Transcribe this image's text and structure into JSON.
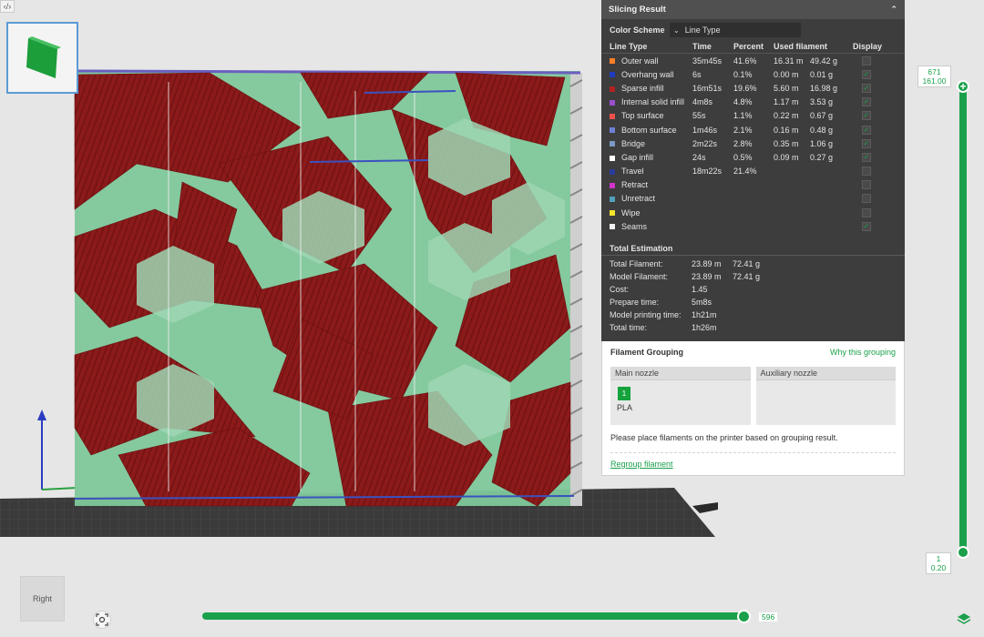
{
  "toolbar": {
    "toggle_label": "‹/›"
  },
  "panel": {
    "title": "Slicing Result",
    "color_scheme_label": "Color Scheme",
    "color_scheme_value": "Line Type",
    "columns": {
      "type": "Line Type",
      "time": "Time",
      "percent": "Percent",
      "filament": "Used filament",
      "display": "Display"
    },
    "rows": [
      {
        "name": "Outer wall",
        "color": "#ff7f27",
        "time": "35m45s",
        "percent": "41.6%",
        "meters": "16.31 m",
        "grams": "49.42 g",
        "checked": false
      },
      {
        "name": "Overhang wall",
        "color": "#1f3cc0",
        "time": "6s",
        "percent": "0.1%",
        "meters": "0.00 m",
        "grams": "0.01 g",
        "checked": true
      },
      {
        "name": "Sparse infill",
        "color": "#b22222",
        "time": "16m51s",
        "percent": "19.6%",
        "meters": "5.60 m",
        "grams": "16.98 g",
        "checked": true
      },
      {
        "name": "Internal solid infill",
        "color": "#9b4fcf",
        "time": "4m8s",
        "percent": "4.8%",
        "meters": "1.17 m",
        "grams": "3.53 g",
        "checked": true
      },
      {
        "name": "Top surface",
        "color": "#f0504a",
        "time": "55s",
        "percent": "1.1%",
        "meters": "0.22 m",
        "grams": "0.67 g",
        "checked": true
      },
      {
        "name": "Bottom surface",
        "color": "#6d80d6",
        "time": "1m46s",
        "percent": "2.1%",
        "meters": "0.16 m",
        "grams": "0.48 g",
        "checked": true
      },
      {
        "name": "Bridge",
        "color": "#7a99c4",
        "time": "2m22s",
        "percent": "2.8%",
        "meters": "0.35 m",
        "grams": "1.06 g",
        "checked": true
      },
      {
        "name": "Gap infill",
        "color": "#ffffff",
        "time": "24s",
        "percent": "0.5%",
        "meters": "0.09 m",
        "grams": "0.27 g",
        "checked": true
      },
      {
        "name": "Travel",
        "color": "#2c3c9c",
        "time": "18m22s",
        "percent": "21.4%",
        "meters": "",
        "grams": "",
        "checked": false
      },
      {
        "name": "Retract",
        "color": "#d233c8",
        "time": "",
        "percent": "",
        "meters": "",
        "grams": "",
        "checked": false
      },
      {
        "name": "Unretract",
        "color": "#4fa0b8",
        "time": "",
        "percent": "",
        "meters": "",
        "grams": "",
        "checked": false
      },
      {
        "name": "Wipe",
        "color": "#f5e52b",
        "time": "",
        "percent": "",
        "meters": "",
        "grams": "",
        "checked": false
      },
      {
        "name": "Seams",
        "color": "#f2f2f2",
        "time": "",
        "percent": "",
        "meters": "",
        "grams": "",
        "checked": true
      }
    ],
    "estimation_title": "Total Estimation",
    "estimation": [
      {
        "label": "Total Filament:",
        "v1": "23.89 m",
        "v2": "72.41 g"
      },
      {
        "label": "Model Filament:",
        "v1": "23.89 m",
        "v2": "72.41 g"
      },
      {
        "label": "Cost:",
        "v1": "1.45",
        "v2": ""
      },
      {
        "label": "Prepare time:",
        "v1": "5m8s",
        "v2": ""
      },
      {
        "label": "Model printing time:",
        "v1": "1h21m",
        "v2": ""
      },
      {
        "label": "Total time:",
        "v1": "1h26m",
        "v2": ""
      }
    ]
  },
  "grouping": {
    "title": "Filament Grouping",
    "why_link": "Why this grouping",
    "main_nozzle": "Main nozzle",
    "aux_nozzle": "Auxiliary nozzle",
    "filament_number": "1",
    "filament_name": "PLA",
    "hint": "Please place filaments on the printer based on grouping result.",
    "regroup_link": "Regroup filament"
  },
  "layer_slider": {
    "top_layer": "671",
    "top_height": "161.00",
    "bottom_layer": "1",
    "bottom_height": "0.20"
  },
  "move_slider": {
    "value": "596"
  },
  "view_cube": {
    "label": "Right"
  },
  "colors": {
    "accent": "#1aa04a",
    "model_red": "#8b1a1a",
    "model_green": "#7fc79a"
  }
}
